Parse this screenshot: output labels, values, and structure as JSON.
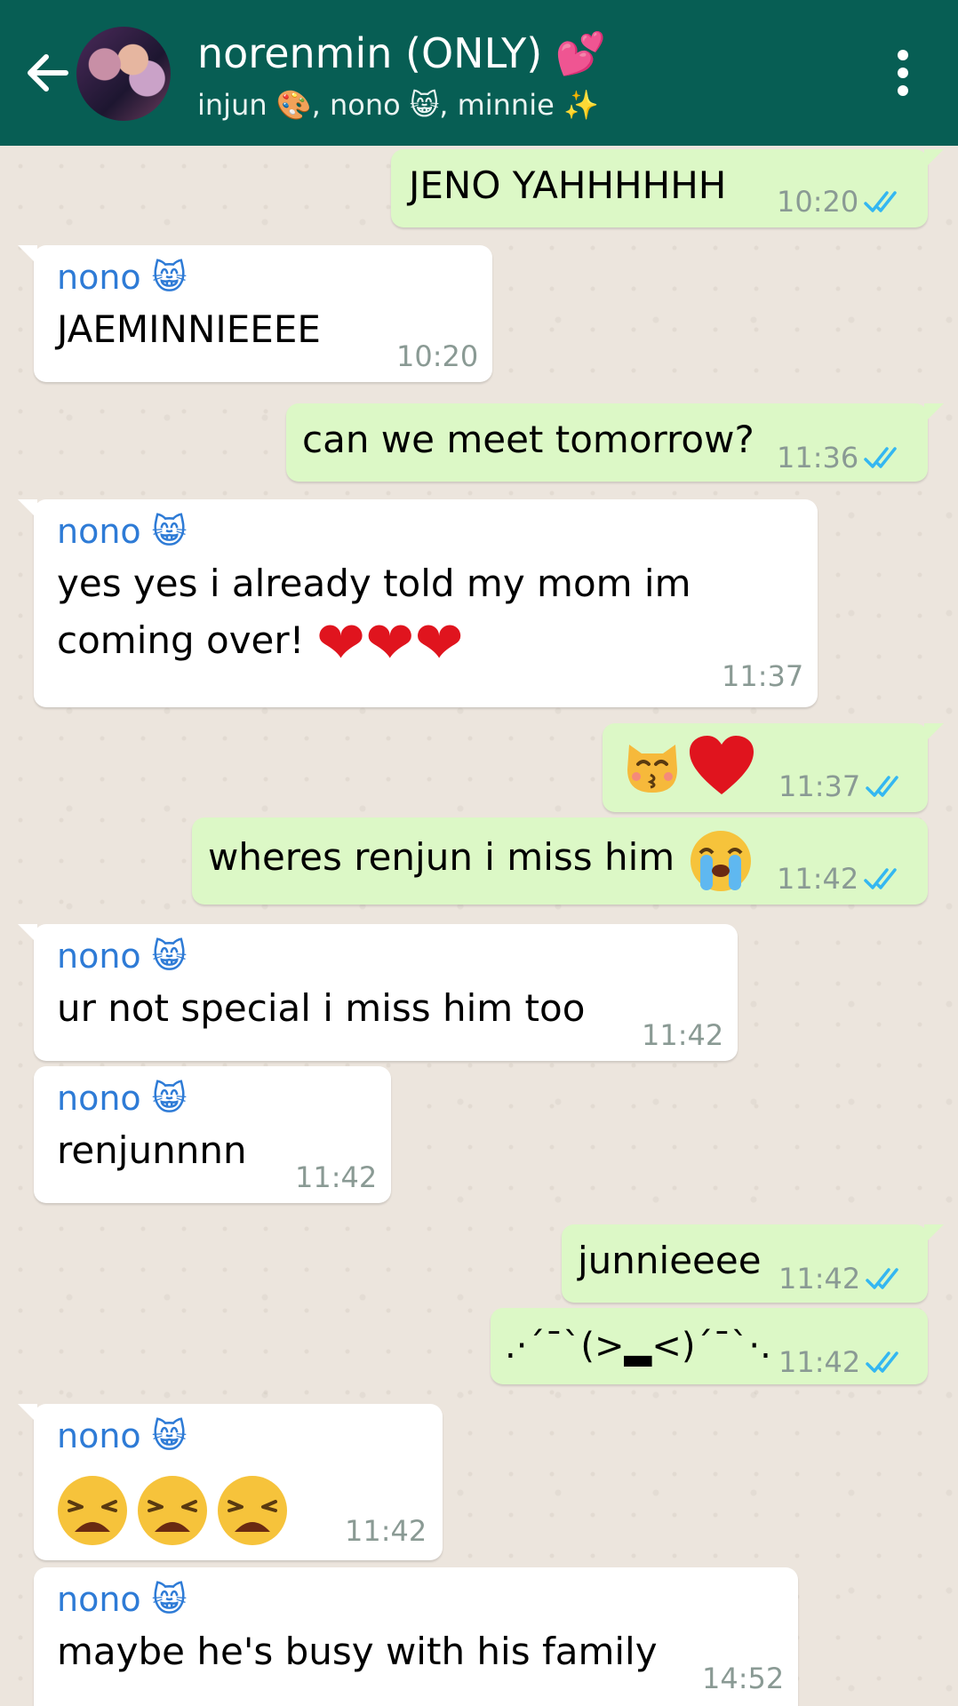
{
  "header": {
    "title": "norenmin (ONLY) 💕",
    "subtitle": "injun 🎨, nono 😸, minnie ✨"
  },
  "colors": {
    "header_bg": "#075e54",
    "incoming_bubble": "#ffffff",
    "outgoing_bubble": "#dcf8c6",
    "sender_name": "#2e7bd6",
    "read_ticks": "#34b7f1"
  },
  "messages": [
    {
      "direction": "out",
      "text": "JENO YAHHHHHH",
      "time": "10:20",
      "status": "read"
    },
    {
      "direction": "in",
      "sender": "nono 😸",
      "text": "JAEMINNIEEEE",
      "time": "10:20"
    },
    {
      "direction": "out",
      "text": "can we meet tomorrow?",
      "time": "11:36",
      "status": "read"
    },
    {
      "direction": "in",
      "sender": "nono 😸",
      "text_line1": "yes yes i already told my mom im",
      "text_line2": "coming over!",
      "time": "11:37",
      "emojis": "heart x3"
    },
    {
      "direction": "out",
      "text": "",
      "emojis": "kissing-cat, heart",
      "time": "11:37",
      "status": "read"
    },
    {
      "direction": "out",
      "text": "wheres renjun i miss him",
      "emojis": "loudly-crying",
      "time": "11:42",
      "status": "read"
    },
    {
      "direction": "in",
      "sender": "nono 😸",
      "text": "ur not special i miss him too",
      "time": "11:42"
    },
    {
      "direction": "in",
      "sender": "nono 😸",
      "text": "renjunnnn",
      "time": "11:42"
    },
    {
      "direction": "out",
      "text": "junnieeee",
      "time": "11:42",
      "status": "read"
    },
    {
      "direction": "out",
      "text": ".·´¯`(>▂<)´¯`·.",
      "time": "11:42",
      "status": "read"
    },
    {
      "direction": "in",
      "sender": "nono 😸",
      "text": "",
      "emojis": "weary x3",
      "time": "11:42"
    },
    {
      "direction": "in",
      "sender": "nono 😸",
      "text": "maybe he's busy with his family",
      "time": "14:52"
    }
  ]
}
